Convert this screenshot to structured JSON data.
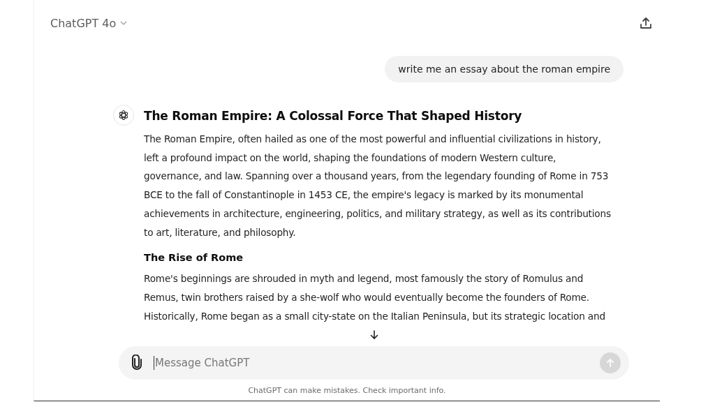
{
  "header": {
    "model": "ChatGPT 4o"
  },
  "user_message": "write me an essay about the roman empire",
  "response": {
    "title": "The Roman Empire: A Colossal Force That Shaped History",
    "paragraph_1": "The Roman Empire, often hailed as one of the most powerful and influential civilizations in history, left a profound impact on the world, shaping the foundations of modern Western culture, governance, and law. Spanning over a thousand years, from the legendary founding of Rome in 753 BCE to the fall of Constantinople in 1453 CE, the empire's legacy is marked by its monumental achievements in architecture, engineering, politics, and military strategy, as well as its contributions to art, literature, and philosophy.",
    "heading": "The Rise of Rome",
    "paragraph_2": "Rome's beginnings are shrouded in myth and legend, most famously the story of Romulus and Remus, twin brothers raised by a she-wolf who would eventually become the founders of Rome. Historically, Rome began as a small city-state on the Italian Peninsula, but its strategic location and"
  },
  "composer": {
    "placeholder": "Message ChatGPT"
  },
  "disclaimer": "ChatGPT can make mistakes. Check important info."
}
